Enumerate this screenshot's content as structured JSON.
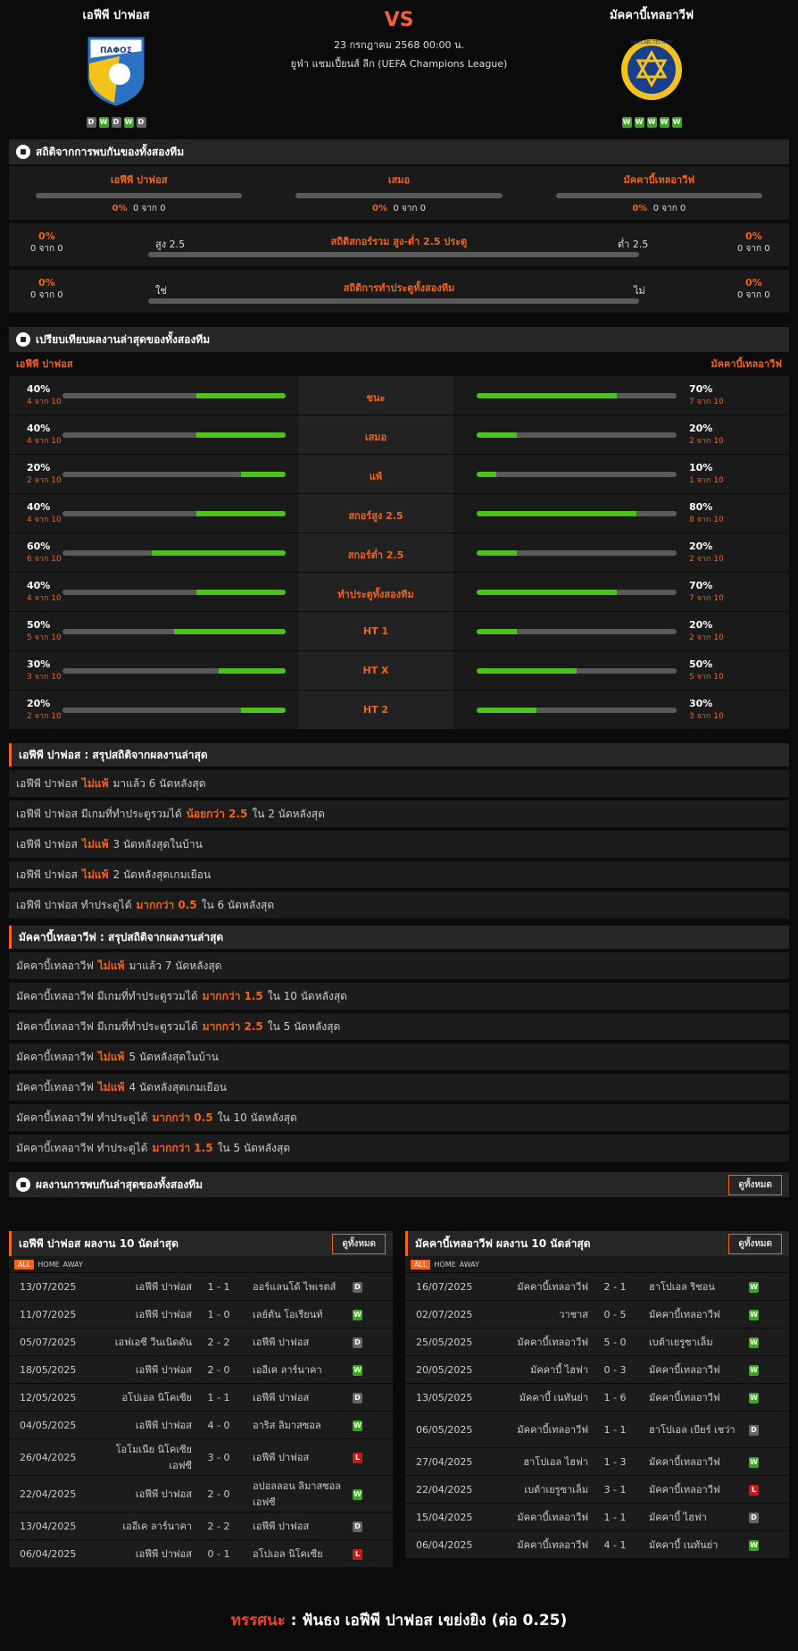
{
  "home": {
    "name": "เอฟีพี ปาฟอส",
    "logo_text": "ΠΑΦΟΣ",
    "form": [
      "D",
      "W",
      "D",
      "W",
      "D"
    ]
  },
  "away": {
    "name": "มัคคาบี้เทลอาวีฟ",
    "logo_text": "MACCABI TEL AVIV",
    "form": [
      "W",
      "W",
      "W",
      "W",
      "W"
    ]
  },
  "match": {
    "vs": "VS",
    "date": "23 กรกฎาคม 2568 00:00 น.",
    "league": "ยูฟ่า แชมเปี้ยนส์ ลีก (UEFA Champions League)"
  },
  "h2h": {
    "title": "สถิติจากการพบกันของทั้งสองทีม",
    "cells": [
      {
        "label": "เอฟีพี ปาฟอส",
        "pct": "0%",
        "of": "0 จาก 0"
      },
      {
        "label": "เสมอ",
        "pct": "0%",
        "of": "0 จาก 0"
      },
      {
        "label": "มัคคาบี้เทลอาวีฟ",
        "pct": "0%",
        "of": "0 จาก 0"
      }
    ],
    "ou": {
      "title": "สถิติสกอร์รวม สูง-ต่ำ 2.5 ประตู",
      "left": "สูง 2.5",
      "right": "ต่ำ 2.5",
      "lp": "0%",
      "lo": "0 จาก 0",
      "rp": "0%",
      "ro": "0 จาก 0"
    },
    "bt": {
      "title": "สถิติการทำประตูทั้งสองทีม",
      "left": "ใช่",
      "right": "ไม่",
      "lp": "0%",
      "lo": "0 จาก 0",
      "rp": "0%",
      "ro": "0 จาก 0"
    }
  },
  "compare": {
    "title": "เปรียบเทียบผลงานล่าสุดของทั้งสองทีม",
    "home": "เอฟีพี ปาฟอส",
    "away": "มัคคาบี้เทลอาวีฟ",
    "rows": [
      {
        "label": "ชนะ",
        "hp": "40%",
        "hs": "4 จาก 10",
        "hv": 0.4,
        "ap": "70%",
        "as": "7 จาก 10",
        "av": 0.7
      },
      {
        "label": "เสมอ",
        "hp": "40%",
        "hs": "4 จาก 10",
        "hv": 0.4,
        "ap": "20%",
        "as": "2 จาก 10",
        "av": 0.2
      },
      {
        "label": "แพ้",
        "hp": "20%",
        "hs": "2 จาก 10",
        "hv": 0.2,
        "ap": "10%",
        "as": "1 จาก 10",
        "av": 0.1
      },
      {
        "label": "สกอร์สูง 2.5",
        "hp": "40%",
        "hs": "4 จาก 10",
        "hv": 0.4,
        "ap": "80%",
        "as": "8 จาก 10",
        "av": 0.8
      },
      {
        "label": "สกอร์ต่ำ 2.5",
        "hp": "60%",
        "hs": "6 จาก 10",
        "hv": 0.6,
        "ap": "20%",
        "as": "2 จาก 10",
        "av": 0.2
      },
      {
        "label": "ทำประตูทั้งสองทีม",
        "hp": "40%",
        "hs": "4 จาก 10",
        "hv": 0.4,
        "ap": "70%",
        "as": "7 จาก 10",
        "av": 0.7
      },
      {
        "label": "HT 1",
        "hp": "50%",
        "hs": "5 จาก 10",
        "hv": 0.5,
        "ap": "20%",
        "as": "2 จาก 10",
        "av": 0.2
      },
      {
        "label": "HT X",
        "hp": "30%",
        "hs": "3 จาก 10",
        "hv": 0.3,
        "ap": "50%",
        "as": "5 จาก 10",
        "av": 0.5
      },
      {
        "label": "HT 2",
        "hp": "20%",
        "hs": "2 จาก 10",
        "hv": 0.2,
        "ap": "30%",
        "as": "3 จาก 10",
        "av": 0.3
      }
    ]
  },
  "home_summary": {
    "title": "เอฟีพี ปาฟอส : สรุปสถิติจากผลงานล่าสุด",
    "rows": [
      [
        "เอฟีพี ปาฟอส",
        "ไม่แพ้",
        "มาแล้ว 6 นัดหลังสุด"
      ],
      [
        "เอฟีพี ปาฟอส  มีเกมที่ทำประตูรวมได้",
        "น้อยกว่า  2.5",
        "ใน 2 นัดหลังสุด"
      ],
      [
        "เอฟีพี ปาฟอส",
        "ไม่แพ้",
        "3  นัดหลังสุดในบ้าน"
      ],
      [
        "เอฟีพี ปาฟอส",
        "ไม่แพ้",
        "2  นัดหลังสุดเกมเยือน"
      ],
      [
        "เอฟีพี ปาฟอส  ทำประตูได้",
        "มากกว่า  0.5",
        "ใน 6 นัดหลังสุด"
      ]
    ]
  },
  "away_summary": {
    "title": "มัคคาบี้เทลอาวีฟ : สรุปสถิติจากผลงานล่าสุด",
    "rows": [
      [
        "มัคคาบี้เทลอาวีฟ",
        "ไม่แพ้",
        "มาแล้ว 7 นัดหลังสุด"
      ],
      [
        "มัคคาบี้เทลอาวีฟ  มีเกมที่ทำประตูรวมได้",
        "มากกว่า  1.5",
        "ใน 10 นัดหลังสุด"
      ],
      [
        "มัคคาบี้เทลอาวีฟ  มีเกมที่ทำประตูรวมได้",
        "มากกว่า  2.5",
        "ใน 5 นัดหลังสุด"
      ],
      [
        "มัคคาบี้เทลอาวีฟ",
        "ไม่แพ้",
        "5  นัดหลังสุดในบ้าน"
      ],
      [
        "มัคคาบี้เทลอาวีฟ",
        "ไม่แพ้",
        "4  นัดหลังสุดเกมเยือน"
      ],
      [
        "มัคคาบี้เทลอาวีฟ  ทำประตูได้",
        "มากกว่า  0.5",
        "ใน 10 นัดหลังสุด"
      ],
      [
        "มัคคาบี้เทลอาวีฟ  ทำประตูได้",
        "มากกว่า  1.5",
        "ใน 5 นัดหลังสุด"
      ]
    ]
  },
  "recent_h2h": {
    "title": "ผลงานการพบกันล่าสุดของทั้งสองทีม",
    "btn": "ดูทั้งหมด"
  },
  "home_last": {
    "title": "เอฟีพี ปาฟอส ผลงาน 10 นัดล่าสุด",
    "btn": "ดูทั้งหมด",
    "filters": [
      "ALL",
      "HOME",
      "AWAY"
    ],
    "rows": [
      [
        "13/07/2025",
        "เอฟีพี ปาฟอส",
        "1 - 1",
        "ออร์แลนโด้ ไพเรตส์",
        "D"
      ],
      [
        "11/07/2025",
        "เอฟีพี ปาฟอส",
        "1 - 0",
        "เลย์ตัน โอเรียนท์",
        "W"
      ],
      [
        "05/07/2025",
        "เอฟเอซี วีนเนิดดัน",
        "2 - 2",
        "เอฟีพี ปาฟอส",
        "D"
      ],
      [
        "18/05/2025",
        "เอฟีพี ปาฟอส",
        "2 - 0",
        "เออีเค ลาร์นาคา",
        "W"
      ],
      [
        "12/05/2025",
        "อโปเอล นิโคเซีย",
        "1 - 1",
        "เอฟีพี ปาฟอส",
        "D"
      ],
      [
        "04/05/2025",
        "เอฟีพี ปาฟอส",
        "4 - 0",
        "อาริส ลิมาสซอล",
        "W"
      ],
      [
        "26/04/2025",
        "โอโมเนีย นิโคเซีย เอฟซี",
        "3 - 0",
        "เอฟีพี ปาฟอส",
        "L"
      ],
      [
        "22/04/2025",
        "เอฟีพี ปาฟอส",
        "2 - 0",
        "อปอลลอน ลิมาสซอล เอฟซี",
        "W"
      ],
      [
        "13/04/2025",
        "เออีเค ลาร์นาคา",
        "2 - 2",
        "เอฟีพี ปาฟอส",
        "D"
      ],
      [
        "06/04/2025",
        "เอฟีพี ปาฟอส",
        "0 - 1",
        "อโปเอล นิโคเซีย",
        "L"
      ]
    ]
  },
  "away_last": {
    "title": "มัคคาบี้เทลอาวีฟ ผลงาน 10 นัดล่าสุด",
    "btn": "ดูทั้งหมด",
    "filters": [
      "ALL",
      "HOME",
      "AWAY"
    ],
    "rows": [
      [
        "16/07/2025",
        "มัคคาบี้เทลอาวีฟ",
        "2 - 1",
        "ฮาโปเอล ริชอน",
        "W"
      ],
      [
        "02/07/2025",
        "วาชาส",
        "0 - 5",
        "มัคคาบี้เทลอาวีฟ",
        "W"
      ],
      [
        "25/05/2025",
        "มัคคาบี้เทลอาวีฟ",
        "5 - 0",
        "เบต้าเยรูซาเล็ม",
        "W"
      ],
      [
        "20/05/2025",
        "มัคคาบี้ ไฮฟา",
        "0 - 3",
        "มัคคาบี้เทลอาวีฟ",
        "W"
      ],
      [
        "13/05/2025",
        "มัคคาบี้ เนทันย่า",
        "1 - 6",
        "มัคคาบี้เทลอาวีฟ",
        "W"
      ],
      [
        "06/05/2025",
        "มัคคาบี้เทลอาวีฟ",
        "1 - 1",
        "ฮาโปเอล เบียร์ เชว่า",
        "D"
      ],
      [
        "27/04/2025",
        "ฮาโปเอล ไฮฟา",
        "1 - 3",
        "มัคคาบี้เทลอาวีฟ",
        "W"
      ],
      [
        "22/04/2025",
        "เบต้าเยรูซาเล็ม",
        "3 - 1",
        "มัคคาบี้เทลอาวีฟ",
        "L"
      ],
      [
        "15/04/2025",
        "มัคคาบี้เทลอาวีฟ",
        "1 - 1",
        "มัคคาบี้ ไฮฟา",
        "D"
      ],
      [
        "06/04/2025",
        "มัคคาบี้เทลอาวีฟ",
        "4 - 1",
        "มัคคาบี้ เนทันย่า",
        "W"
      ]
    ]
  },
  "verdict": {
    "label": "ทรรศนะ",
    "sep": " : ",
    "text": "ฟันธง เอฟีพี ปาฟอส เขย่งยิง (ต่อ 0.25)"
  }
}
